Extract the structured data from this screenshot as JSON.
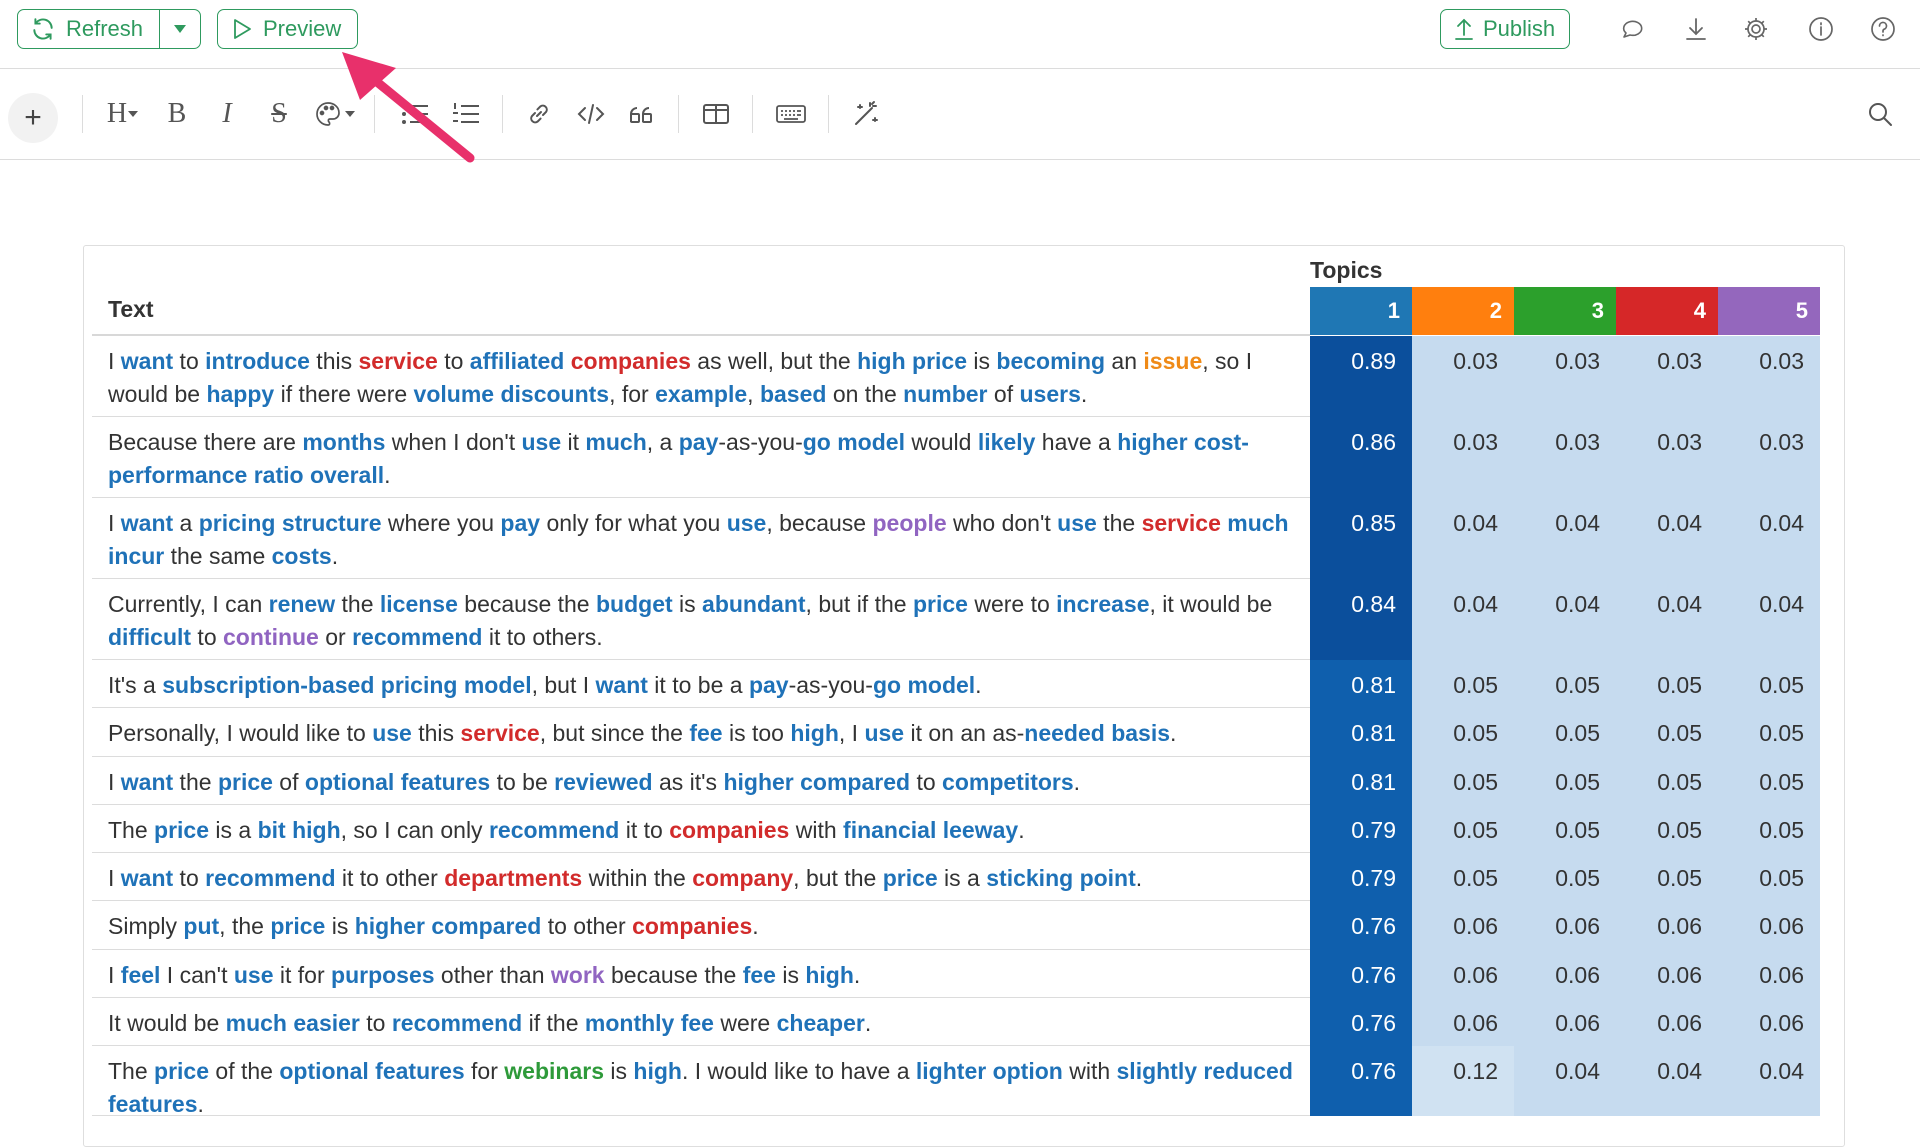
{
  "topbar": {
    "refresh_label": "Refresh",
    "preview_label": "Preview",
    "publish_label": "Publish",
    "icons": [
      "comment-icon",
      "download-icon",
      "settings-icon",
      "info-icon",
      "help-icon"
    ]
  },
  "toolbar": {
    "add_label": "+",
    "heading_label": "H",
    "bold_label": "B",
    "italic_label": "I",
    "strike_label": "S"
  },
  "colors": {
    "accent_green": "#2e9a5e",
    "annotation_arrow": "#e8306b",
    "topic_1": "#1f77b4",
    "topic_2": "#ff7f0e",
    "topic_3": "#2ca02c",
    "topic_4": "#d62728",
    "topic_5": "#9467bd",
    "cell_dark": "#0b4f9c",
    "cell_mid": "#0f5fad",
    "cell_light": "#c6dbef",
    "cell_lighter": "#d0e2f2"
  },
  "table": {
    "topics_label": "Topics",
    "text_header": "Text",
    "topic_headers": [
      "1",
      "2",
      "3",
      "4",
      "5"
    ],
    "rows": [
      {
        "segments": [
          [
            "I ",
            ""
          ],
          [
            "want",
            "blue"
          ],
          [
            " to ",
            ""
          ],
          [
            "introduce",
            "blue"
          ],
          [
            " this ",
            ""
          ],
          [
            "service",
            "red"
          ],
          [
            " to ",
            ""
          ],
          [
            "affiliated",
            "blue"
          ],
          [
            " ",
            ""
          ],
          [
            "companies",
            "red"
          ],
          [
            " as well, but the ",
            ""
          ],
          [
            "high",
            "blue"
          ],
          [
            " ",
            ""
          ],
          [
            "price",
            "blue"
          ],
          [
            " is ",
            ""
          ],
          [
            "becoming",
            "blue"
          ],
          [
            " an ",
            ""
          ],
          [
            "issue",
            "orange"
          ],
          [
            ", so I would be ",
            ""
          ],
          [
            "happy",
            "blue"
          ],
          [
            " if there were ",
            ""
          ],
          [
            "volume",
            "blue"
          ],
          [
            " ",
            ""
          ],
          [
            "discounts",
            "blue"
          ],
          [
            ", for ",
            ""
          ],
          [
            "example",
            "blue"
          ],
          [
            ", ",
            ""
          ],
          [
            "based",
            "blue"
          ],
          [
            " on the ",
            ""
          ],
          [
            "number",
            "blue"
          ],
          [
            " of ",
            ""
          ],
          [
            "users",
            "blue"
          ],
          [
            ".",
            ""
          ]
        ],
        "values": [
          "0.89",
          "0.03",
          "0.03",
          "0.03",
          "0.03"
        ]
      },
      {
        "segments": [
          [
            "Because there are ",
            ""
          ],
          [
            "months",
            "blue"
          ],
          [
            " when I don't ",
            ""
          ],
          [
            "use",
            "blue"
          ],
          [
            " it ",
            ""
          ],
          [
            "much",
            "blue"
          ],
          [
            ", a ",
            ""
          ],
          [
            "pay",
            "blue"
          ],
          [
            "-as-you-",
            ""
          ],
          [
            "go",
            "blue"
          ],
          [
            " ",
            ""
          ],
          [
            "model",
            "blue"
          ],
          [
            " would ",
            ""
          ],
          [
            "likely",
            "blue"
          ],
          [
            " have a ",
            ""
          ],
          [
            "higher",
            "blue"
          ],
          [
            " ",
            ""
          ],
          [
            "cost-performance",
            "blue"
          ],
          [
            " ",
            ""
          ],
          [
            "ratio",
            "blue"
          ],
          [
            " ",
            ""
          ],
          [
            "overall",
            "blue"
          ],
          [
            ".",
            ""
          ]
        ],
        "values": [
          "0.86",
          "0.03",
          "0.03",
          "0.03",
          "0.03"
        ]
      },
      {
        "segments": [
          [
            "I ",
            ""
          ],
          [
            "want",
            "blue"
          ],
          [
            " a ",
            ""
          ],
          [
            "pricing",
            "blue"
          ],
          [
            " ",
            ""
          ],
          [
            "structure",
            "blue"
          ],
          [
            " where you ",
            ""
          ],
          [
            "pay",
            "blue"
          ],
          [
            " only for what you ",
            ""
          ],
          [
            "use",
            "blue"
          ],
          [
            ", because ",
            ""
          ],
          [
            "people",
            "purple"
          ],
          [
            " who don't ",
            ""
          ],
          [
            "use",
            "blue"
          ],
          [
            " the ",
            ""
          ],
          [
            "service",
            "red"
          ],
          [
            " ",
            ""
          ],
          [
            "much",
            "blue"
          ],
          [
            " ",
            ""
          ],
          [
            "incur",
            "blue"
          ],
          [
            " the same ",
            ""
          ],
          [
            "costs",
            "blue"
          ],
          [
            ".",
            ""
          ]
        ],
        "values": [
          "0.85",
          "0.04",
          "0.04",
          "0.04",
          "0.04"
        ]
      },
      {
        "segments": [
          [
            "Currently, I can ",
            ""
          ],
          [
            "renew",
            "blue"
          ],
          [
            " the ",
            ""
          ],
          [
            "license",
            "blue"
          ],
          [
            " because the ",
            ""
          ],
          [
            "budget",
            "blue"
          ],
          [
            " is ",
            ""
          ],
          [
            "abundant",
            "blue"
          ],
          [
            ", but if the ",
            ""
          ],
          [
            "price",
            "blue"
          ],
          [
            " were to ",
            ""
          ],
          [
            "increase",
            "blue"
          ],
          [
            ", it would be ",
            ""
          ],
          [
            "difficult",
            "blue"
          ],
          [
            " to ",
            ""
          ],
          [
            "continue",
            "purple"
          ],
          [
            " or ",
            ""
          ],
          [
            "recommend",
            "blue"
          ],
          [
            " it to others.",
            ""
          ]
        ],
        "values": [
          "0.84",
          "0.04",
          "0.04",
          "0.04",
          "0.04"
        ]
      },
      {
        "segments": [
          [
            "It's a ",
            ""
          ],
          [
            "subscription-based",
            "blue"
          ],
          [
            " ",
            ""
          ],
          [
            "pricing",
            "blue"
          ],
          [
            " ",
            ""
          ],
          [
            "model",
            "blue"
          ],
          [
            ", but I ",
            ""
          ],
          [
            "want",
            "blue"
          ],
          [
            " it to be a ",
            ""
          ],
          [
            "pay",
            "blue"
          ],
          [
            "-as-you-",
            ""
          ],
          [
            "go",
            "blue"
          ],
          [
            " ",
            ""
          ],
          [
            "model",
            "blue"
          ],
          [
            ".",
            ""
          ]
        ],
        "values": [
          "0.81",
          "0.05",
          "0.05",
          "0.05",
          "0.05"
        ]
      },
      {
        "segments": [
          [
            "Personally, I would like to ",
            ""
          ],
          [
            "use",
            "blue"
          ],
          [
            " this ",
            ""
          ],
          [
            "service",
            "red"
          ],
          [
            ", but since the ",
            ""
          ],
          [
            "fee",
            "blue"
          ],
          [
            " is too ",
            ""
          ],
          [
            "high",
            "blue"
          ],
          [
            ", I ",
            ""
          ],
          [
            "use",
            "blue"
          ],
          [
            " it on an as-",
            ""
          ],
          [
            "needed",
            "blue"
          ],
          [
            " ",
            ""
          ],
          [
            "basis",
            "blue"
          ],
          [
            ".",
            ""
          ]
        ],
        "values": [
          "0.81",
          "0.05",
          "0.05",
          "0.05",
          "0.05"
        ]
      },
      {
        "segments": [
          [
            "I ",
            ""
          ],
          [
            "want",
            "blue"
          ],
          [
            " the ",
            ""
          ],
          [
            "price",
            "blue"
          ],
          [
            " of ",
            ""
          ],
          [
            "optional",
            "blue"
          ],
          [
            " ",
            ""
          ],
          [
            "features",
            "blue"
          ],
          [
            " to be ",
            ""
          ],
          [
            "reviewed",
            "blue"
          ],
          [
            " as it's ",
            ""
          ],
          [
            "higher",
            "blue"
          ],
          [
            " ",
            ""
          ],
          [
            "compared",
            "blue"
          ],
          [
            " to ",
            ""
          ],
          [
            "competitors",
            "blue"
          ],
          [
            ".",
            ""
          ]
        ],
        "values": [
          "0.81",
          "0.05",
          "0.05",
          "0.05",
          "0.05"
        ]
      },
      {
        "segments": [
          [
            "The ",
            ""
          ],
          [
            "price",
            "blue"
          ],
          [
            " is a ",
            ""
          ],
          [
            "bit",
            "blue"
          ],
          [
            " ",
            ""
          ],
          [
            "high",
            "blue"
          ],
          [
            ", so I can only ",
            ""
          ],
          [
            "recommend",
            "blue"
          ],
          [
            " it to ",
            ""
          ],
          [
            "companies",
            "red"
          ],
          [
            " with ",
            ""
          ],
          [
            "financial",
            "blue"
          ],
          [
            " ",
            ""
          ],
          [
            "leeway",
            "blue"
          ],
          [
            ".",
            ""
          ]
        ],
        "values": [
          "0.79",
          "0.05",
          "0.05",
          "0.05",
          "0.05"
        ]
      },
      {
        "segments": [
          [
            "I ",
            ""
          ],
          [
            "want",
            "blue"
          ],
          [
            " to ",
            ""
          ],
          [
            "recommend",
            "blue"
          ],
          [
            " it to other ",
            ""
          ],
          [
            "departments",
            "red"
          ],
          [
            " within the ",
            ""
          ],
          [
            "company",
            "red"
          ],
          [
            ", but the ",
            ""
          ],
          [
            "price",
            "blue"
          ],
          [
            " is a ",
            ""
          ],
          [
            "sticking",
            "blue"
          ],
          [
            " ",
            ""
          ],
          [
            "point",
            "blue"
          ],
          [
            ".",
            ""
          ]
        ],
        "values": [
          "0.79",
          "0.05",
          "0.05",
          "0.05",
          "0.05"
        ]
      },
      {
        "segments": [
          [
            "Simply ",
            ""
          ],
          [
            "put",
            "blue"
          ],
          [
            ", the ",
            ""
          ],
          [
            "price",
            "blue"
          ],
          [
            " is ",
            ""
          ],
          [
            "higher",
            "blue"
          ],
          [
            " ",
            ""
          ],
          [
            "compared",
            "blue"
          ],
          [
            " to other ",
            ""
          ],
          [
            "companies",
            "red"
          ],
          [
            ".",
            ""
          ]
        ],
        "values": [
          "0.76",
          "0.06",
          "0.06",
          "0.06",
          "0.06"
        ]
      },
      {
        "segments": [
          [
            "I ",
            ""
          ],
          [
            "feel",
            "blue"
          ],
          [
            " I can't ",
            ""
          ],
          [
            "use",
            "blue"
          ],
          [
            " it for ",
            ""
          ],
          [
            "purposes",
            "blue"
          ],
          [
            " other than ",
            ""
          ],
          [
            "work",
            "purple"
          ],
          [
            " because the ",
            ""
          ],
          [
            "fee",
            "blue"
          ],
          [
            " is ",
            ""
          ],
          [
            "high",
            "blue"
          ],
          [
            ".",
            ""
          ]
        ],
        "values": [
          "0.76",
          "0.06",
          "0.06",
          "0.06",
          "0.06"
        ]
      },
      {
        "segments": [
          [
            "It would be ",
            ""
          ],
          [
            "much",
            "blue"
          ],
          [
            " ",
            ""
          ],
          [
            "easier",
            "blue"
          ],
          [
            " to ",
            ""
          ],
          [
            "recommend",
            "blue"
          ],
          [
            " if the ",
            ""
          ],
          [
            "monthly",
            "blue"
          ],
          [
            " ",
            ""
          ],
          [
            "fee",
            "blue"
          ],
          [
            " were ",
            ""
          ],
          [
            "cheaper",
            "blue"
          ],
          [
            ".",
            ""
          ]
        ],
        "values": [
          "0.76",
          "0.06",
          "0.06",
          "0.06",
          "0.06"
        ]
      },
      {
        "segments": [
          [
            "The ",
            ""
          ],
          [
            "price",
            "blue"
          ],
          [
            " of the ",
            ""
          ],
          [
            "optional",
            "blue"
          ],
          [
            " ",
            ""
          ],
          [
            "features",
            "blue"
          ],
          [
            " for ",
            ""
          ],
          [
            "webinars",
            "green"
          ],
          [
            " is ",
            ""
          ],
          [
            "high",
            "blue"
          ],
          [
            ". I would like to have a ",
            ""
          ],
          [
            "lighter",
            "blue"
          ],
          [
            " ",
            ""
          ],
          [
            "option",
            "blue"
          ],
          [
            " with ",
            ""
          ],
          [
            "slightly",
            "blue"
          ],
          [
            " ",
            ""
          ],
          [
            "reduced",
            "blue"
          ],
          [
            " ",
            ""
          ],
          [
            "features",
            "blue"
          ],
          [
            ".",
            ""
          ]
        ],
        "values": [
          "0.76",
          "0.12",
          "0.04",
          "0.04",
          "0.04"
        ]
      }
    ]
  }
}
